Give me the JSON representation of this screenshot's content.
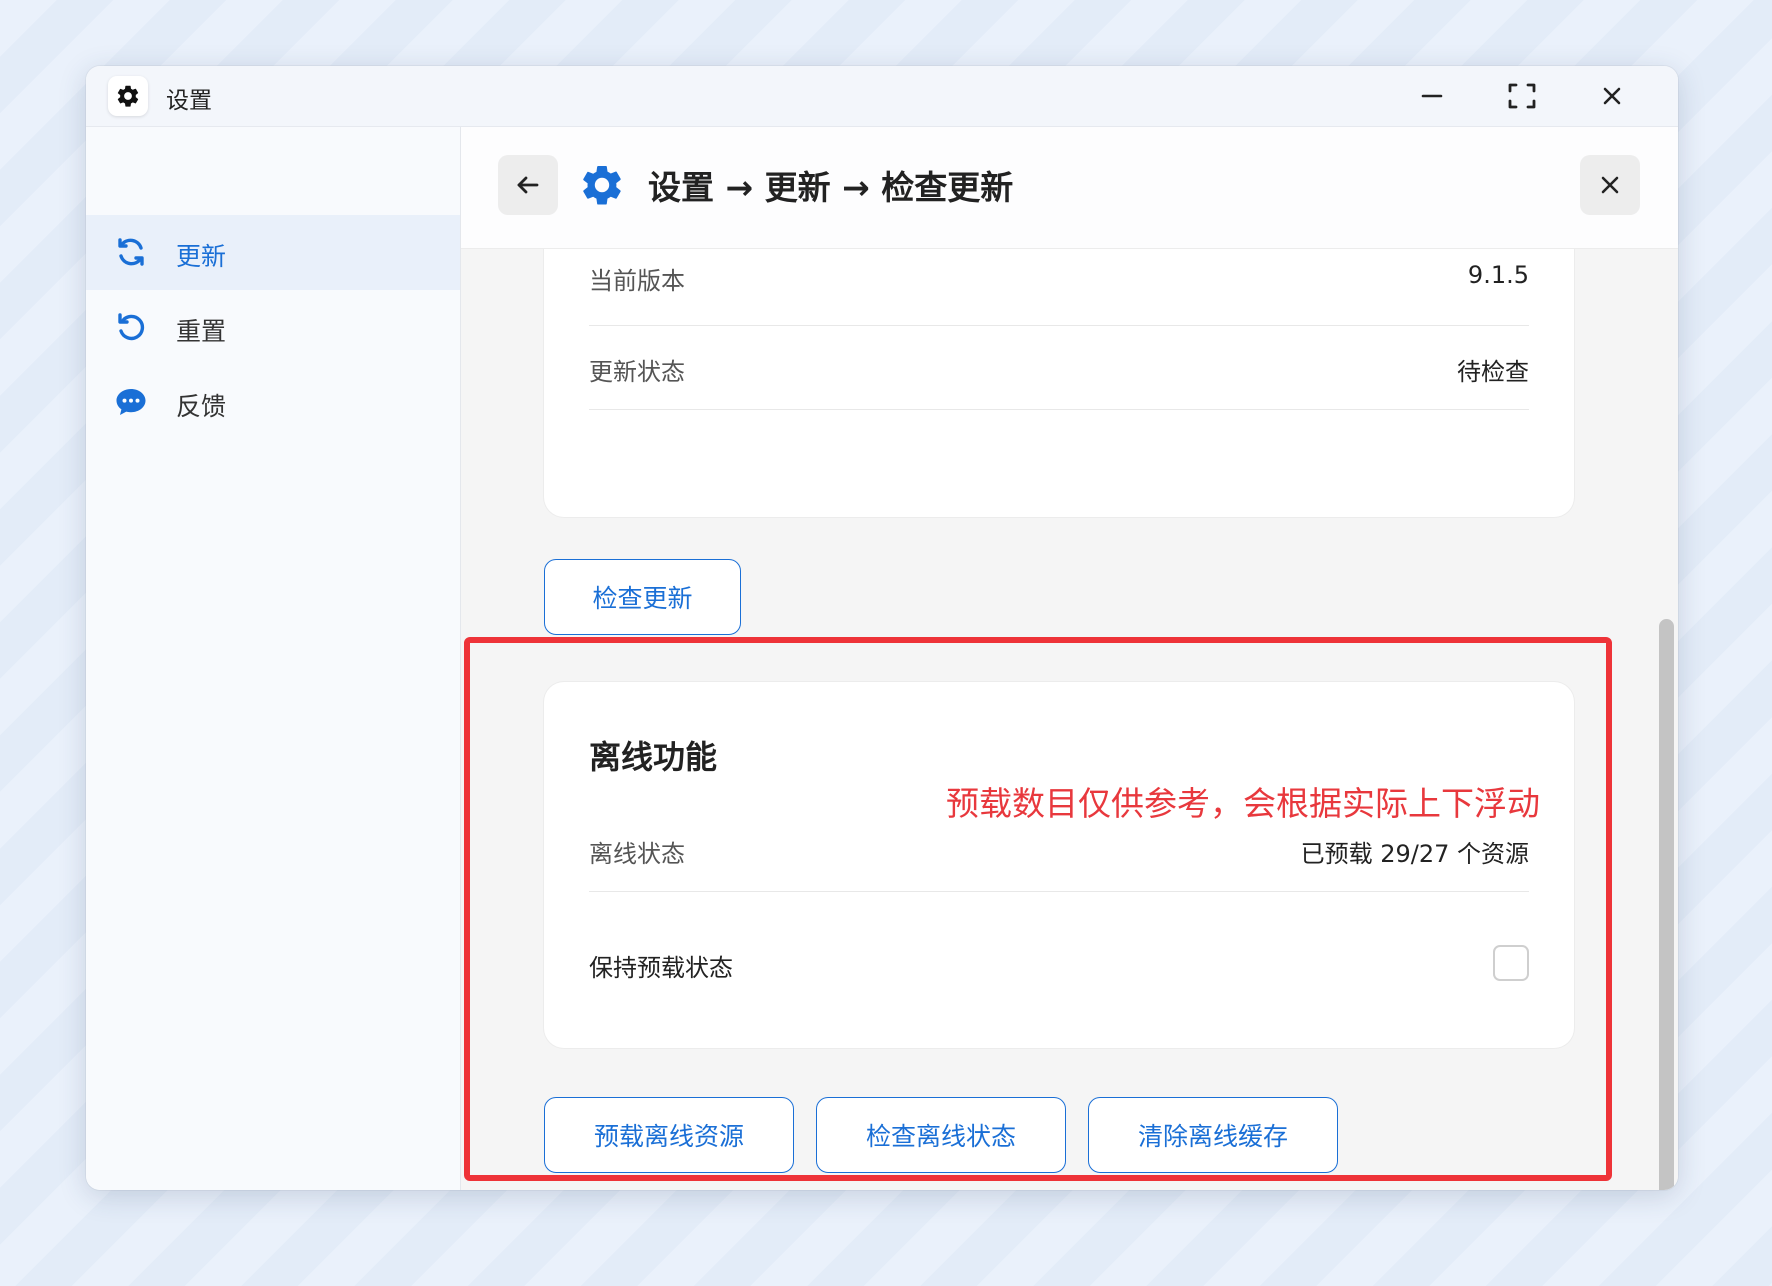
{
  "window": {
    "title": "设置",
    "app_icon": "gear-icon",
    "controls": [
      "minimize-icon",
      "fullscreen-icon",
      "close-icon"
    ]
  },
  "sidebar": {
    "items": [
      {
        "label": "更新",
        "icon": "refresh-icon",
        "active": true
      },
      {
        "label": "重置",
        "icon": "undo-icon",
        "active": false
      },
      {
        "label": "反馈",
        "icon": "chat-bubble-icon",
        "active": false
      }
    ]
  },
  "header": {
    "breadcrumb": "设置 → 更新 → 检查更新",
    "back_icon": "arrow-left-icon",
    "close_icon": "close-icon"
  },
  "version_card": {
    "rows": [
      {
        "label": "当前版本",
        "value": "9.1.5"
      },
      {
        "label": "更新状态",
        "value": "待检查"
      }
    ]
  },
  "check_update_button": "检查更新",
  "offline_card": {
    "title": "离线功能",
    "annotation": "预载数目仅供参考，会根据实际上下浮动",
    "status_label": "离线状态",
    "status_value": "已预载 29/27 个资源",
    "keep_label": "保持预载状态",
    "keep_checked": false
  },
  "offline_buttons": {
    "preload": "预载离线资源",
    "check": "检查离线状态",
    "clear": "清除离线缓存"
  },
  "colors": {
    "accent": "#1a6fd6",
    "highlight": "#ee3338"
  }
}
